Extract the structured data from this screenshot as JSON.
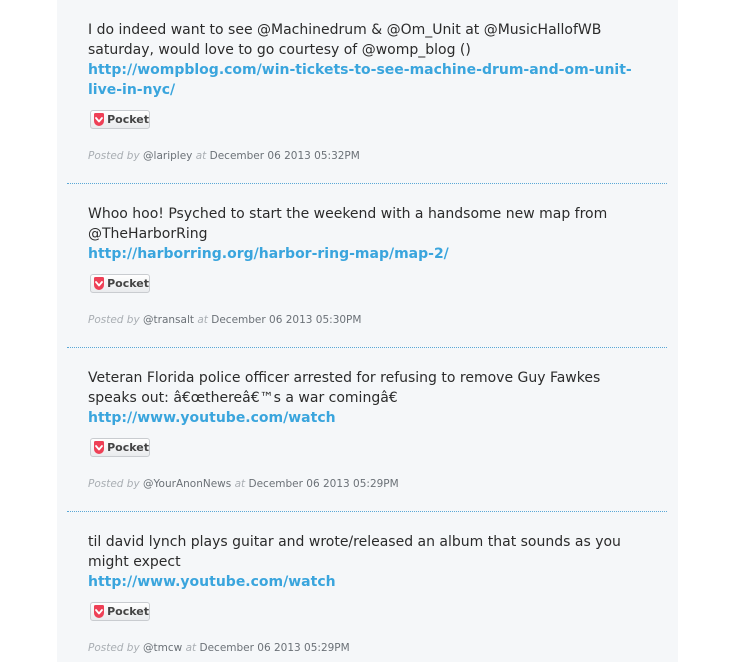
{
  "posts": [
    {
      "text": "I do indeed want to see @Machinedrum & @Om_Unit at @MusicHallofWB saturday, would love to go courtesy of @womp_blog ()",
      "link": "http://wompblog.com/win-tickets-to-see-machine-drum-and-om-unit-live-in-nyc/",
      "pocket_label": "Pocket",
      "posted_by_label": "Posted by",
      "author": "@laripley",
      "at_label": "at",
      "date": "December 06 2013 05:32PM"
    },
    {
      "text": "Whoo hoo! Psyched to start the weekend with a handsome new map from @TheHarborRing",
      "link": "http://harborring.org/harbor-ring-map/map-2/",
      "pocket_label": "Pocket",
      "posted_by_label": "Posted by",
      "author": "@transalt",
      "at_label": "at",
      "date": "December 06 2013 05:30PM"
    },
    {
      "text": "Veteran Florida police officer arrested for refusing to remove Guy Fawkes speaks out: â€œthereâ€™s a war comingâ€",
      "link": "http://www.youtube.com/watch",
      "pocket_label": "Pocket",
      "posted_by_label": "Posted by",
      "author": "@YourAnonNews",
      "at_label": "at",
      "date": "December 06 2013 05:29PM"
    },
    {
      "text": "til david lynch plays guitar and wrote/released an album that sounds as you might expect",
      "link": "http://www.youtube.com/watch",
      "pocket_label": "Pocket",
      "posted_by_label": "Posted by",
      "author": "@tmcw",
      "at_label": "at",
      "date": "December 06 2013 05:29PM"
    }
  ],
  "icons": {
    "pocket": "pocket-icon"
  },
  "colors": {
    "link": "#3aa5dd",
    "divider": "#5aa8d6",
    "pocket": "#ee4056"
  }
}
